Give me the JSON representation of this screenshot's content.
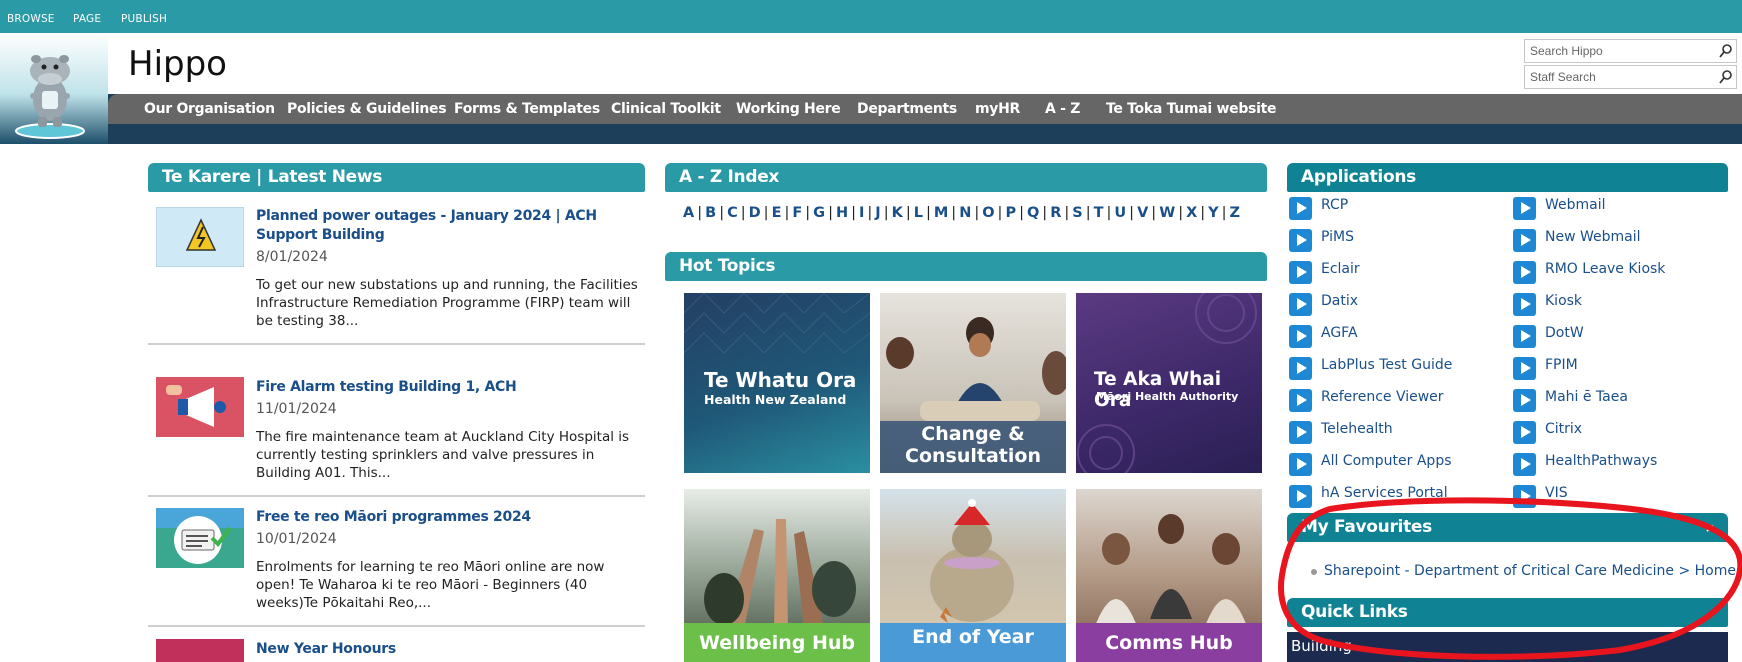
{
  "ribbon": {
    "browse": "BROWSE",
    "page": "PAGE",
    "publish": "PUBLISH"
  },
  "site": {
    "title": "Hippo"
  },
  "search": {
    "hippo_placeholder": "Search Hippo",
    "staff_placeholder": "Staff Search"
  },
  "nav": [
    "Our Organisation",
    "Policies & Guidelines",
    "Forms & Templates",
    "Clinical Toolkit",
    "Working Here",
    "Departments",
    "myHR",
    "A - Z",
    "Te Toka Tumai website"
  ],
  "news": {
    "heading": "Te Karere | Latest News",
    "items": [
      {
        "title": "Planned power outages - January 2024 | ACH Support Building",
        "date": "8/01/2024",
        "body": "To get our new substations up and running, the Facilities Infrastructure Remediation Programme (FIRP) team will be testing 38..."
      },
      {
        "title": "Fire Alarm testing Building 1, ACH",
        "date": "11/01/2024",
        "body": "The fire maintenance team at Auckland City Hospital is currently testing sprinklers and valve pressures in Building A01. This..."
      },
      {
        "title": "Free te reo Māori programmes 2024",
        "date": "10/01/2024",
        "body": "Enrolments for learning te reo Māori online are now open! Te Waharoa ki te reo Māori - Beginners (40 weeks)Te Pōkaitahi Reo,..."
      },
      {
        "title": "New Year Honours",
        "date": "",
        "body": ""
      }
    ]
  },
  "az_index": {
    "heading": "A - Z Index",
    "letters": [
      "A",
      "B",
      "C",
      "D",
      "E",
      "F",
      "G",
      "H",
      "I",
      "J",
      "K",
      "L",
      "M",
      "N",
      "O",
      "P",
      "Q",
      "R",
      "S",
      "T",
      "U",
      "V",
      "W",
      "X",
      "Y",
      "Z"
    ]
  },
  "hot_topics": {
    "heading": "Hot Topics",
    "tiles": [
      {
        "line1": "Te Whatu Ora",
        "line2": "Health New Zealand"
      },
      {
        "line1": "Change &",
        "line2": "Consultation"
      },
      {
        "line1": "Te Aka Whai Ora",
        "line2": "Māori Health Authority"
      },
      {
        "line1": "Wellbeing Hub",
        "line2": ""
      },
      {
        "line1": "End of Year",
        "line2": ""
      },
      {
        "line1": "Comms Hub",
        "line2": ""
      }
    ]
  },
  "applications": {
    "heading": "Applications",
    "left": [
      "RCP",
      "PiMS",
      "Eclair",
      "Datix",
      "AGFA",
      "LabPlus Test Guide",
      "Reference Viewer",
      "Telehealth",
      "All Computer Apps",
      "hA Services Portal"
    ],
    "right": [
      "Webmail",
      "New Webmail",
      "RMO Leave Kiosk",
      "Kiosk",
      "DotW",
      "FPIM",
      "Mahi ē Taea",
      "Citrix",
      "HealthPathways",
      "VIS"
    ]
  },
  "favourites": {
    "heading": "My Favourites",
    "items": [
      "Sharepoint - Department of Critical Care Medicine > Home"
    ]
  },
  "quick_links": {
    "heading": "Quick Links",
    "first": "Building"
  },
  "colors": {
    "teal": "#2a9aa6",
    "dark_teal": "#0f8393",
    "navy": "#1d3f5a",
    "link": "#1a4f8a",
    "annotation": "#e8141e"
  }
}
